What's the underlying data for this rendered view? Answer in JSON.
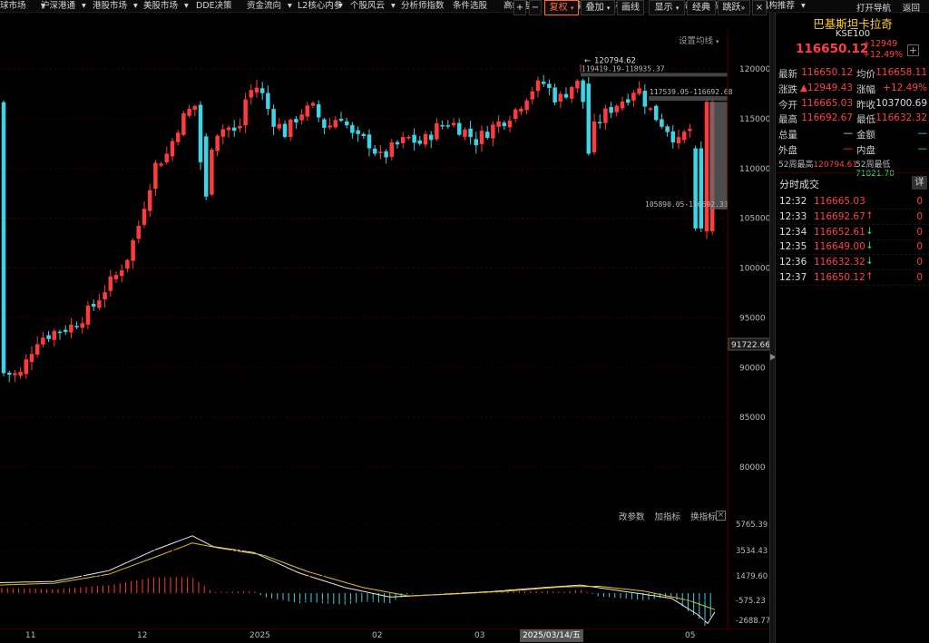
{
  "nav": {
    "items": [
      {
        "label": "球市场",
        "caret": true
      },
      {
        "label": "沪深港通",
        "caret": true
      },
      {
        "label": "港股市场",
        "caret": true
      },
      {
        "label": "美股市场",
        "caret": true
      },
      {
        "label": "DDE决策",
        "caret": false
      },
      {
        "label": "资金流向",
        "caret": true
      },
      {
        "label": "L2核心内参",
        "caret": true
      },
      {
        "label": "个股风云",
        "caret": true
      },
      {
        "label": "分析师指数",
        "caret": false
      },
      {
        "label": "条件选股",
        "caret": false
      },
      {
        "label": "高级选股",
        "caret": false
      },
      {
        "label": "选股器",
        "caret": false
      },
      {
        "label": "机构增仓",
        "caret": false
      },
      {
        "label": "热点追击",
        "caret": false
      },
      {
        "label": "高成长性",
        "caret": false
      },
      {
        "label": "机构推荐",
        "caret": true
      }
    ],
    "right": {
      "guide": "打开导航",
      "back": "返回"
    }
  },
  "toolbar": {
    "plus": "+",
    "minus": "−",
    "fuquan": "复权",
    "diejia": "叠加",
    "huaxian": "画线",
    "xianshi": "显示",
    "jingdian": "经典",
    "shuanglian": "跳跃",
    "settings_ma": "设置均线"
  },
  "chart": {
    "price_axis": [
      "120000",
      "115000",
      "110000",
      "105000",
      "100000",
      "95000",
      "90000",
      "85000",
      "80000"
    ],
    "current_price_tag": "91722.66",
    "high_annotation": "120794.62",
    "range_label_1": "119419.19-118935.37",
    "range_label_2": "117539.05-116692.68",
    "range_label_3": "105890.05-116692.33",
    "indicator_axis": [
      "5765.39",
      "3534.43",
      "1479.60",
      "-575.23",
      "-2688.77"
    ],
    "indicator_buttons": {
      "params": "改参数",
      "add": "加指标",
      "switch": "换指标",
      "close": "×"
    },
    "time_axis": [
      "11",
      "12",
      "2025",
      "02",
      "03",
      "05"
    ],
    "cursor_date": "2025/03/14/五"
  },
  "chart_data": {
    "type": "candlestick",
    "series": [
      {
        "name": "KSE100"
      }
    ],
    "yrange": [
      76000,
      123000
    ],
    "high": 120794.62,
    "low_visible": 88500,
    "indicator": {
      "type": "macd",
      "yrange": [
        -2688.77,
        5765.39
      ]
    }
  },
  "panel": {
    "name": "巴基斯坦卡拉奇",
    "code": "KSE100",
    "price": "116650.12",
    "change": "+12949",
    "change_pct": "+12.49%",
    "rows": [
      {
        "l1": "最新",
        "v1": "116650.12",
        "c1": "red",
        "l2": "均价",
        "v2": "116658.11",
        "c2": "red"
      },
      {
        "l1": "涨跌",
        "v1": "▲12949.43",
        "c1": "red",
        "l2": "涨幅",
        "v2": "+12.49%",
        "c2": "red"
      },
      {
        "l1": "今开",
        "v1": "116665.03",
        "c1": "red",
        "l2": "昨收",
        "v2": "103700.69",
        "c2": "white"
      },
      {
        "l1": "最高",
        "v1": "116692.67",
        "c1": "red",
        "l2": "最低",
        "v2": "116632.32",
        "c2": "red"
      },
      {
        "l1": "总量",
        "v1": "—",
        "c1": "white",
        "l2": "金额",
        "v2": "—",
        "c2": "cyan"
      },
      {
        "l1": "外盘",
        "v1": "—",
        "c1": "red",
        "l2": "内盘",
        "v2": "—",
        "c2": "green"
      }
    ],
    "w52_high_label": "52周最高",
    "w52_high": "120794.61",
    "w52_low_label": "52周最低",
    "w52_low": "71821.70",
    "ticks_title": "分时成交",
    "ticks_detail": "详",
    "ticks": [
      {
        "time": "12:32",
        "price": "116665.03",
        "dir": "",
        "vol": "0"
      },
      {
        "time": "12:33",
        "price": "116692.67",
        "dir": "↑",
        "vol": "0"
      },
      {
        "time": "12:34",
        "price": "116652.61",
        "dir": "↓",
        "vol": "0"
      },
      {
        "time": "12:35",
        "price": "116649.00",
        "dir": "↓",
        "vol": "0"
      },
      {
        "time": "12:36",
        "price": "116632.32",
        "dir": "↓",
        "vol": "0"
      },
      {
        "time": "12:37",
        "price": "116650.12",
        "dir": "↑",
        "vol": "0"
      }
    ]
  }
}
